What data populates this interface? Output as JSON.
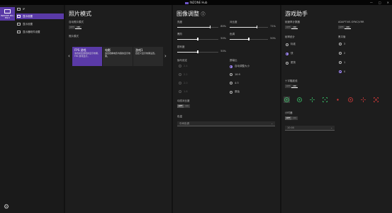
{
  "window": {
    "title": "INZONE Hub",
    "controls": [
      "—",
      "□",
      "✕"
    ]
  },
  "sidebar": {
    "device_name": "INZONE M9 / M9 II",
    "items": [
      {
        "label": "IP",
        "active": false
      },
      {
        "label": "显示设置",
        "active": true
      },
      {
        "label": "显示设置",
        "active": false
      },
      {
        "label": "显示器软件设置",
        "active": false
      }
    ]
  },
  "photo_panel": {
    "title": "照片模式",
    "auto_label": "自动照片模式",
    "auto_toggle": {
      "off": "OFF",
      "on": "ON"
    },
    "mode_label": "照片模式",
    "modes": [
      {
        "title": "FPS 游戏",
        "desc": "适合射击游戏的显示效果，FPS 游戏显示。",
        "active": true
      },
      {
        "title": "电影",
        "desc": "适合观看电影内容的显示效果。",
        "active": false
      },
      {
        "title": "游戏1",
        "desc": "自定义显示效果设置。",
        "active": false
      }
    ]
  },
  "image_panel": {
    "title": "图像调整",
    "help_icon": "help-circle-icon",
    "sliders_left": [
      {
        "label": "亮度",
        "value": "80%",
        "fill": 0.8
      },
      {
        "label": "黑阶",
        "value": "50%",
        "fill": 0.5
      },
      {
        "label": "锐利度",
        "value": "50%",
        "fill": 0.5
      }
    ],
    "sliders_right": [
      {
        "label": "对比度",
        "value": "71%",
        "fill": 0.71
      },
      {
        "label": "色调",
        "value": "50%",
        "fill": 0.5
      }
    ],
    "gamma_label": "伽马设定",
    "gamma_options": [
      "2.4",
      "2.2",
      "2.0",
      "1.8"
    ],
    "aspect_label": "屏幕比",
    "aspect_options": [
      "自动调整大小",
      "16:9",
      "4:3",
      "原始"
    ],
    "aspect_selected": 0,
    "dynamic_label": "动态对比度",
    "dynamic_toggle": {
      "off": "OFF",
      "on": "ON"
    },
    "color_label": "色温",
    "color_value": "中间色调"
  },
  "game_panel": {
    "title": "游戏助手",
    "refresh_label": "帧速率计数器",
    "refresh_toggle": {
      "off": "OFF",
      "on": "ON"
    },
    "vrr_label": "ADAPTIVE-SYNC/VRR",
    "vrr_toggle": {
      "off": "OFF",
      "on": "ON"
    },
    "position_label": "帧率统计",
    "positions": [
      "标准",
      "快",
      "更快"
    ],
    "position_selected": 1,
    "level_label": "黑平衡",
    "levels": [
      "3",
      "2",
      "1",
      "0"
    ],
    "level_selected": 3,
    "crosshair_label": "十字瞄准线",
    "crosshair_toggle": {
      "off": "OFF",
      "on": "ON"
    },
    "crosshairs": [
      {
        "icon": "crosshair-ring-dot-icon",
        "color": "#3ac26a"
      },
      {
        "icon": "crosshair-ring-dot-icon",
        "color": "#3ac26a"
      },
      {
        "icon": "crosshair-plus-icon",
        "color": "#3ac26a"
      },
      {
        "icon": "crosshair-bracket-icon",
        "color": "#3ac26a"
      },
      {
        "icon": "crosshair-dot-icon",
        "color": "#d43a3a"
      },
      {
        "icon": "crosshair-ring-dot-icon",
        "color": "#d43a3a"
      },
      {
        "icon": "crosshair-plus-icon",
        "color": "#d43a3a"
      },
      {
        "icon": "crosshair-bracket-icon",
        "color": "#d43a3a"
      }
    ],
    "timer_label": "计时器",
    "timer_toggle": {
      "off": "OFF",
      "on": "ON"
    },
    "timer_value": "10:00"
  }
}
